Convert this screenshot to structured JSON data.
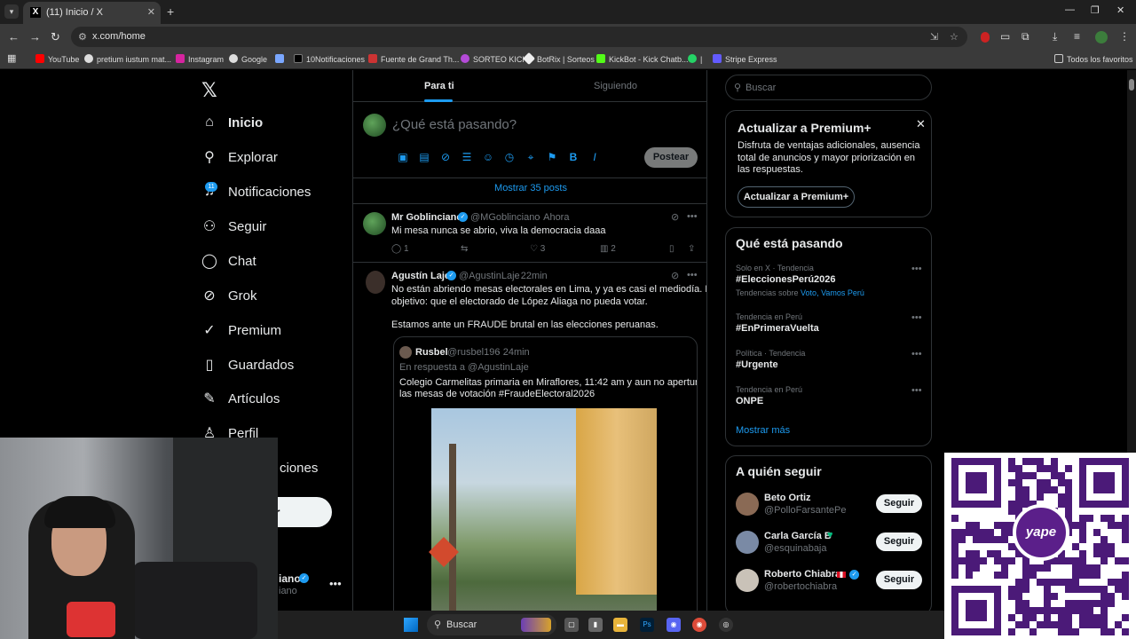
{
  "browser": {
    "tab_title": "(11) Inicio / X",
    "url": "x.com/home",
    "bookmarks": [
      "YouTube",
      "pretium iustum mat...",
      "Instagram",
      "Google",
      "10Notificaciones",
      "Fuente de Grand Th...",
      "SORTEO KICK",
      "BotRix | Sorteos",
      "KickBot - Kick Chatb...",
      "|",
      "Stripe Express"
    ],
    "all_bookmarks": "Todos los favoritos"
  },
  "nav": {
    "logo": "𝕏",
    "items": [
      {
        "label": "Inicio",
        "icon": "home-icon"
      },
      {
        "label": "Explorar",
        "icon": "search-icon"
      },
      {
        "label": "Notificaciones",
        "icon": "bell-icon"
      },
      {
        "label": "Seguir",
        "icon": "person-add-icon"
      },
      {
        "label": "Chat",
        "icon": "chat-icon"
      },
      {
        "label": "Grok",
        "icon": "grok-icon"
      },
      {
        "label": "Premium",
        "icon": "premium-icon"
      },
      {
        "label": "Guardados",
        "icon": "bookmark-icon"
      },
      {
        "label": "Artículos",
        "icon": "article-icon"
      },
      {
        "label": "Perfil",
        "icon": "profile-icon"
      },
      {
        "label": "ciones",
        "icon": "more-icon"
      }
    ],
    "notif_count": "11",
    "post_label": "r",
    "account_name": "iano",
    "account_handle": "iano"
  },
  "feed": {
    "tabs": [
      "Para ti",
      "Siguiendo"
    ],
    "compose_placeholder": "¿Qué está pasando?",
    "post_button": "Postear",
    "show_posts": "Mostrar 35 posts",
    "tweets": [
      {
        "name": "Mr Goblinciano",
        "handle": "@MGoblinciano",
        "time": "· Ahora",
        "text": "Mi mesa nunca se abrio, viva la democracia daaa",
        "replies": "1",
        "likes": "3",
        "views": "2"
      },
      {
        "name": "Agustín Laje",
        "handle": "@AgustinLaje",
        "time": "· 22min",
        "text_line1": "No están abriendo mesas electorales en Lima, y ya es casi el mediodía. El",
        "text_line2": "objetivo: que el electorado de López Aliaga no pueda votar.",
        "text_line3": "Estamos ante un FRAUDE brutal en las elecciones peruanas.",
        "quote": {
          "name": "Rusbel",
          "handle": "@rusbel196",
          "time": "· 24min",
          "reply_to": "En respuesta a @AgustinLaje",
          "text_line1": "Colegio Carmelitas primaria en Miraflores,  11:42 am y aun no aperturan",
          "text_line2": "las mesas de votación #FraudeElectoral2026"
        }
      }
    ]
  },
  "sidebar": {
    "search_placeholder": "Buscar",
    "premium": {
      "title": "Actualizar a Premium+",
      "text": "Disfruta de ventajas adicionales, ausencia total de anuncios y mayor priorización en las respuestas.",
      "button": "Actualizar a Premium+"
    },
    "trends": {
      "title": "Qué está pasando",
      "items": [
        {
          "context": "Solo en X · Tendencia",
          "name": "#EleccionesPerú2026",
          "sub_prefix": "Tendencias sobre ",
          "sub_links": "Voto, Vamos Perú"
        },
        {
          "context": "Tendencia en Perú",
          "name": "#EnPrimeraVuelta"
        },
        {
          "context": "Política · Tendencia",
          "name": "#Urgente"
        },
        {
          "context": "Tendencia en Perú",
          "name": "ONPE"
        }
      ],
      "show_more": "Mostrar más"
    },
    "who_to_follow": {
      "title": "A quién seguir",
      "follow_label": "Seguir",
      "users": [
        {
          "name": "Beto Ortiz",
          "handle": "@PolloFarsantePe"
        },
        {
          "name": "Carla García B",
          "handle": "@esquinabaja"
        },
        {
          "name": "Roberto Chiabra",
          "handle": "@robertochiabra"
        }
      ]
    }
  },
  "overlay": {
    "qr_label": "yape"
  },
  "taskbar": {
    "search_label": "Buscar"
  }
}
